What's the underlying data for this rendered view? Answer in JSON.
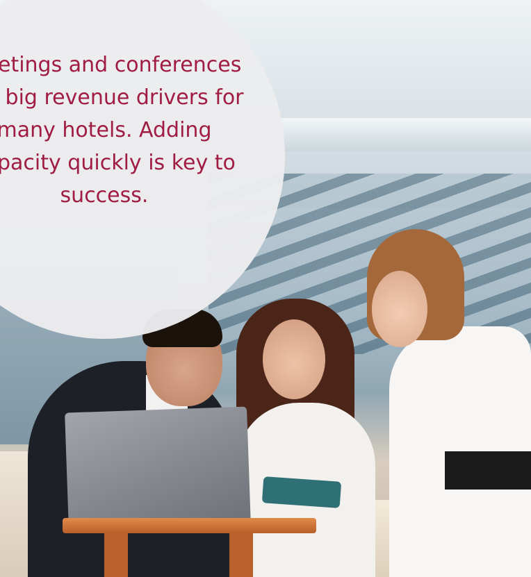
{
  "callout": {
    "text": "Meetings and conferences are big revenue drivers for many hotels. Adding capacity quickly is key to success."
  },
  "colors": {
    "callout_text": "#a01c42",
    "callout_circle": "#ececee"
  }
}
